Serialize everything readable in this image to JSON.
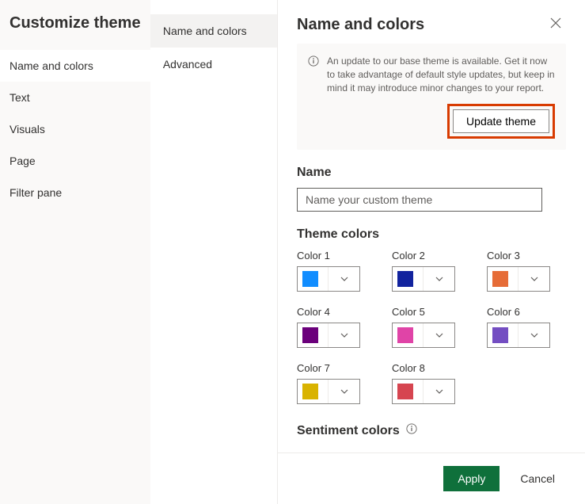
{
  "leftTitle": "Customize theme",
  "nav1": {
    "items": [
      {
        "label": "Name and colors",
        "selected": true
      },
      {
        "label": "Text"
      },
      {
        "label": "Visuals"
      },
      {
        "label": "Page"
      },
      {
        "label": "Filter pane"
      }
    ]
  },
  "nav2": {
    "items": [
      {
        "label": "Name and colors",
        "selected": true
      },
      {
        "label": "Advanced"
      }
    ]
  },
  "panel": {
    "title": "Name and colors",
    "info": "An update to our base theme is available. Get it now to take advantage of default style updates, but keep in mind it may introduce minor changes to your report.",
    "updateBtn": "Update theme",
    "nameHeading": "Name",
    "namePlaceholder": "Name your custom theme",
    "themeColorsHeading": "Theme colors",
    "colors": [
      {
        "label": "Color 1",
        "hex": "#118dff"
      },
      {
        "label": "Color 2",
        "hex": "#12239e"
      },
      {
        "label": "Color 3",
        "hex": "#e66c37"
      },
      {
        "label": "Color 4",
        "hex": "#6b007b"
      },
      {
        "label": "Color 5",
        "hex": "#e044a7"
      },
      {
        "label": "Color 6",
        "hex": "#744ec2"
      },
      {
        "label": "Color 7",
        "hex": "#d9b300"
      },
      {
        "label": "Color 8",
        "hex": "#d64550"
      }
    ],
    "sentimentHeading": "Sentiment colors"
  },
  "footer": {
    "apply": "Apply",
    "cancel": "Cancel"
  }
}
